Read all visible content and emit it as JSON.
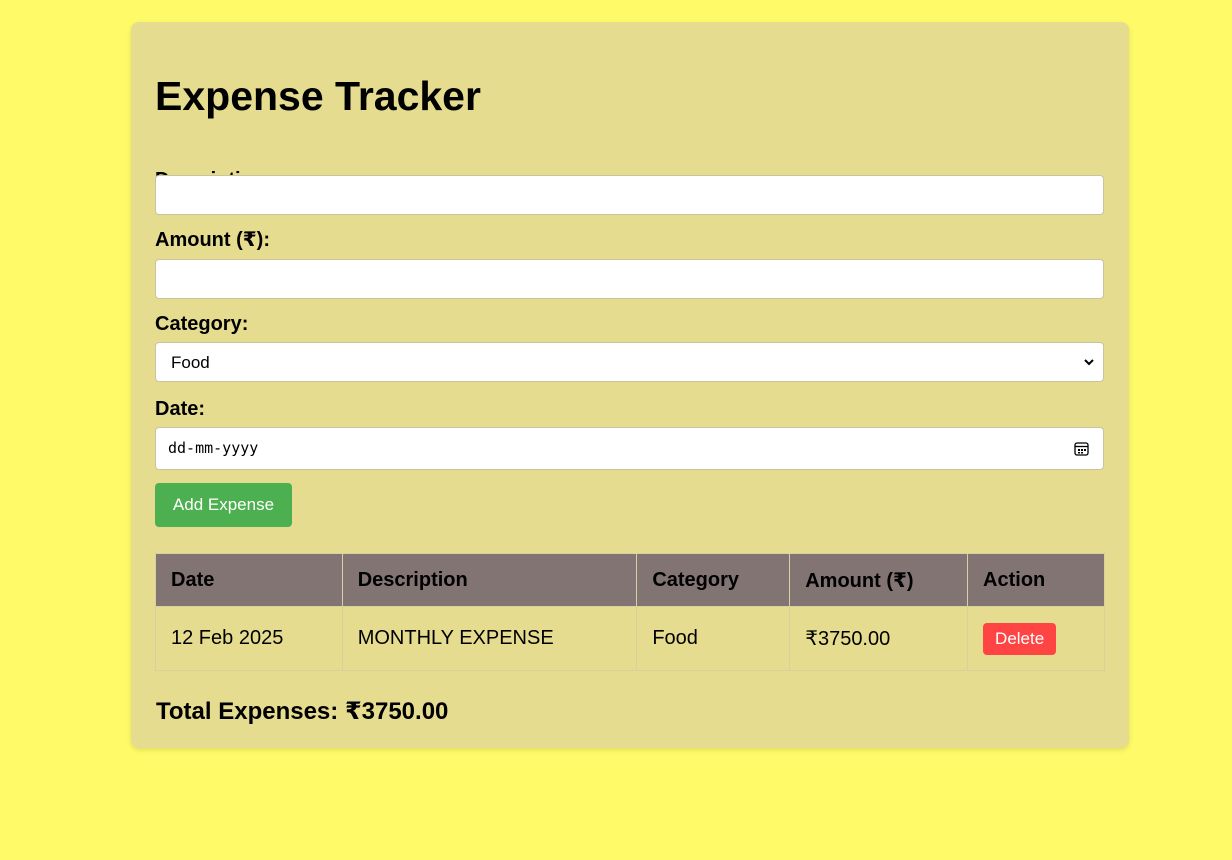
{
  "app": {
    "title": "Expense Tracker"
  },
  "form": {
    "description_label": "Description:",
    "description_value": "",
    "amount_label": "Amount (₹):",
    "amount_value": "",
    "category_label": "Category:",
    "category_value": "Food",
    "date_label": "Date:",
    "date_placeholder": "dd-mm-yyyy",
    "add_button_label": "Add Expense"
  },
  "table": {
    "headers": [
      "Date",
      "Description",
      "Category",
      "Amount (₹)",
      "Action"
    ],
    "rows": [
      {
        "date": "12 Feb 2025",
        "description": "MONTHLY EXPENSE",
        "category": "Food",
        "amount": "₹3750.00",
        "action_label": "Delete"
      }
    ]
  },
  "summary": {
    "total_text": "Total Expenses: ₹3750.00"
  },
  "colors": {
    "page_background": "#fffb68",
    "card_background": "#e5dc8f",
    "add_button": "#4caf50",
    "delete_button": "#ff4444",
    "table_header": "#837474"
  },
  "icons": {
    "category_dropdown": "chevron-down-icon",
    "date_picker": "calendar-icon"
  }
}
